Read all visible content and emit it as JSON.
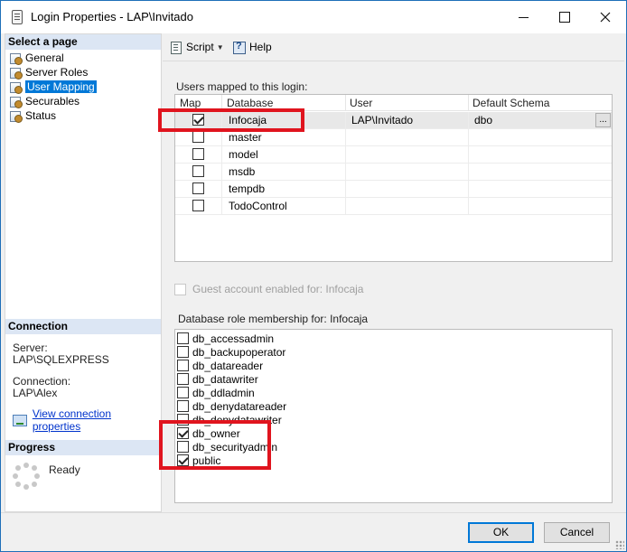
{
  "window": {
    "title": "Login Properties - LAP\\Invitado"
  },
  "left": {
    "select_page_header": "Select a page",
    "pages": [
      {
        "label": "General",
        "selected": false
      },
      {
        "label": "Server Roles",
        "selected": false
      },
      {
        "label": "User Mapping",
        "selected": true
      },
      {
        "label": "Securables",
        "selected": false
      },
      {
        "label": "Status",
        "selected": false
      }
    ],
    "connection_header": "Connection",
    "server_label": "Server:",
    "server_value": "LAP\\SQLEXPRESS",
    "connection_label": "Connection:",
    "connection_value": "LAP\\Alex",
    "view_connection_link": "View connection properties",
    "progress_header": "Progress",
    "progress_status": "Ready"
  },
  "toolbar": {
    "script_label": "Script",
    "help_label": "Help"
  },
  "mapping": {
    "label": "Users mapped to this login:",
    "columns": [
      "Map",
      "Database",
      "User",
      "Default Schema"
    ],
    "rows": [
      {
        "map": true,
        "database": "Infocaja",
        "user": "LAP\\Invitado",
        "schema": "dbo"
      },
      {
        "map": false,
        "database": "master",
        "user": "",
        "schema": ""
      },
      {
        "map": false,
        "database": "model",
        "user": "",
        "schema": ""
      },
      {
        "map": false,
        "database": "msdb",
        "user": "",
        "schema": ""
      },
      {
        "map": false,
        "database": "tempdb",
        "user": "",
        "schema": ""
      },
      {
        "map": false,
        "database": "TodoControl",
        "user": "",
        "schema": ""
      }
    ],
    "ellipsis": "..."
  },
  "guest": {
    "label": "Guest account enabled for: Infocaja",
    "checked": false
  },
  "roles": {
    "label": "Database role membership for: Infocaja",
    "items": [
      {
        "label": "db_accessadmin",
        "checked": false
      },
      {
        "label": "db_backupoperator",
        "checked": false
      },
      {
        "label": "db_datareader",
        "checked": false
      },
      {
        "label": "db_datawriter",
        "checked": false
      },
      {
        "label": "db_ddladmin",
        "checked": false
      },
      {
        "label": "db_denydatareader",
        "checked": false
      },
      {
        "label": "db_denydatawriter",
        "checked": false
      },
      {
        "label": "db_owner",
        "checked": true
      },
      {
        "label": "db_securityadmin",
        "checked": false
      },
      {
        "label": "public",
        "checked": true
      }
    ]
  },
  "buttons": {
    "ok": "OK",
    "cancel": "Cancel"
  },
  "colors": {
    "selection": "#0078d7",
    "highlight_box": "#e0141e",
    "link": "#0033cc"
  }
}
